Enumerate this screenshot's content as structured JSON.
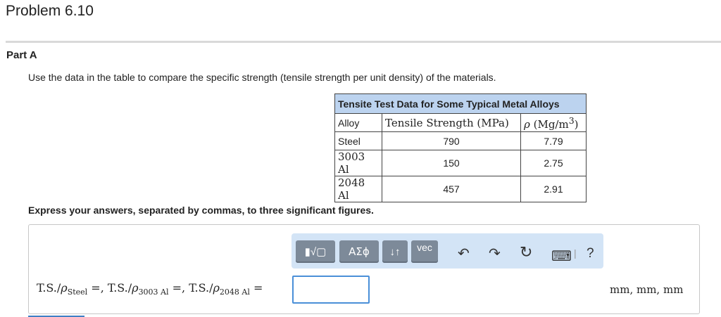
{
  "header": {
    "title": "Problem 6.10"
  },
  "part": {
    "label": "Part A"
  },
  "instruction": "Use the data in the table to compare the specific strength (tensile strength per unit density) of the materials.",
  "table": {
    "caption": "Tensite Test Data for Some Typical Metal Alloys",
    "headers": {
      "alloy": "Alloy",
      "strength": "Tensile Strength (MPa)",
      "density_symbol": "ρ",
      "density_unit": "(Mg/m",
      "density_exp": "3",
      "density_close": ")"
    },
    "rows": [
      {
        "alloy": "Steel",
        "strength": "790",
        "density": "7.79"
      },
      {
        "alloy": "3003 Al",
        "strength": "150",
        "density": "2.75"
      },
      {
        "alloy": "2048 Al",
        "strength": "457",
        "density": "2.91"
      }
    ]
  },
  "express": "Express your answers, separated by commas, to three significant figures.",
  "toolbar": {
    "template_label": "▮√▢",
    "greek_label": "ΑΣϕ",
    "arrows_label": "↓↑",
    "vec_label": "vec",
    "undo_icon": "↶",
    "redo_icon": "↷",
    "reset_icon": "↻",
    "keyboard_icon": "⌨",
    "separator": "|",
    "help_label": "?"
  },
  "equation": {
    "ts": "T.S./",
    "rho": "ρ",
    "sub1": "Steel",
    "sub2": "3003 Al",
    "sub3": "2048 Al",
    "eqcomma": "=,",
    "eq": "="
  },
  "units": "mm, mm, mm"
}
